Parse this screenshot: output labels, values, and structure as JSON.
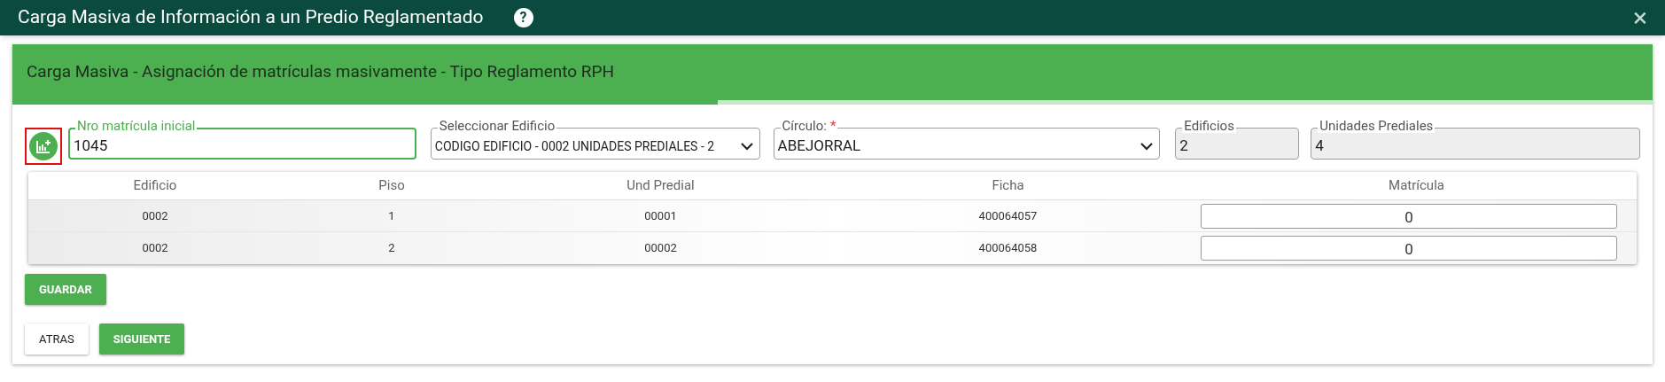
{
  "window": {
    "title": "Carga Masiva de Información a un Predio Reglamentado",
    "help": "?",
    "close": "×"
  },
  "header": {
    "title": "Carga Masiva - Asignación de matrículas masivamente - Tipo Reglamento RPH",
    "progress": {
      "level": 0.43
    }
  },
  "form": {
    "add_button": {
      "highlighted": true
    },
    "fields": [
      {
        "kind": "input",
        "label": "Nro matrícula inicial",
        "value": "1045",
        "focused": true
      },
      {
        "kind": "select",
        "label": "Seleccionar Edificio",
        "value": "CODIGO EDIFICIO - 0002 UNIDADES PREDIALES - 2",
        "focused": false
      },
      {
        "kind": "select",
        "label": "Círculo:",
        "value": "ABEJORRAL",
        "focused": false,
        "required_mark": "*"
      },
      {
        "kind": "readonly",
        "label": "Edificios",
        "value": "2",
        "focused": false
      },
      {
        "kind": "readonly",
        "label": "Unidades Prediales",
        "value": "4",
        "focused": false
      }
    ]
  },
  "table": {
    "columns": [
      "Edificio",
      "Piso",
      "Und Predial",
      "Ficha",
      "Matrícula"
    ],
    "rows": [
      [
        "0002",
        "1",
        "00001",
        "400064057",
        "0"
      ],
      [
        "0002",
        "2",
        "00002",
        "400064058",
        "0"
      ]
    ]
  },
  "buttons": [
    {
      "label": "GUARDAR",
      "primary": true
    }
  ],
  "nav_buttons": [
    {
      "label": "ATRAS",
      "primary": false
    },
    {
      "label": "SIGUIENTE",
      "primary": true
    }
  ]
}
